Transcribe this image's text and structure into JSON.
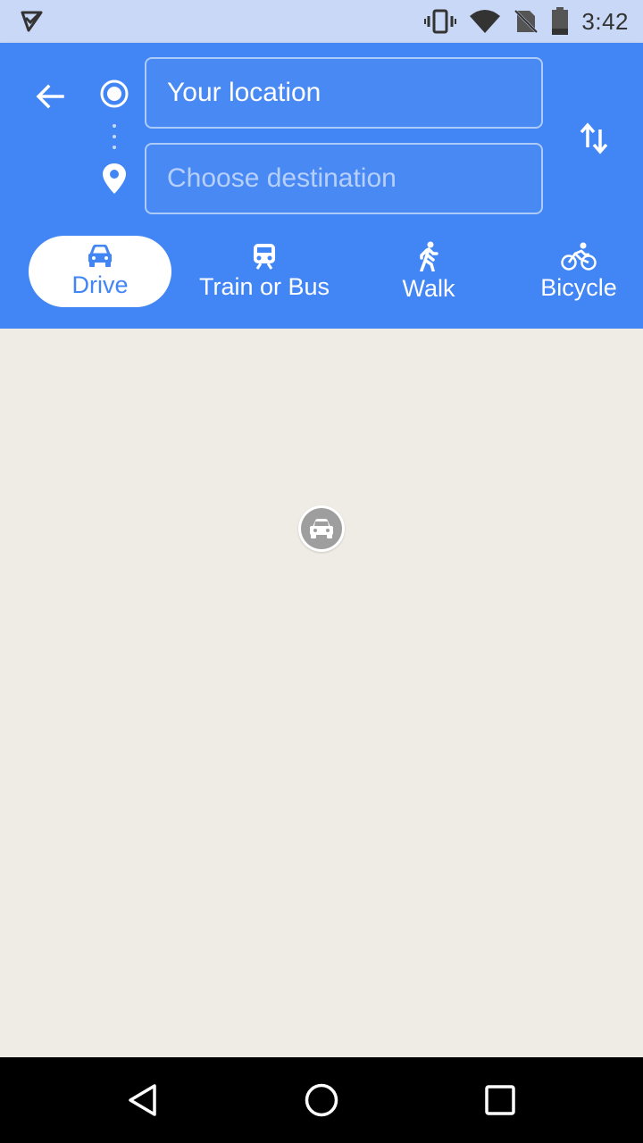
{
  "status_bar": {
    "time": "3:42",
    "icons": [
      "play-store-notification-icon",
      "vibrate-icon",
      "wifi-icon",
      "no-sim-icon",
      "battery-icon"
    ]
  },
  "directions": {
    "origin_value": "Your location",
    "destination_placeholder": "Choose destination",
    "back_icon": "arrow-back-icon",
    "swap_icon": "swap-vert-icon"
  },
  "modes": [
    {
      "label": "Drive",
      "icon": "car-icon",
      "selected": true
    },
    {
      "label": "Train or Bus",
      "icon": "train-icon",
      "selected": false
    },
    {
      "label": "Walk",
      "icon": "walk-icon",
      "selected": false
    },
    {
      "label": "Bicycle",
      "icon": "bicycle-icon",
      "selected": false
    }
  ],
  "map": {
    "background_color": "#efebe5",
    "marker_icon": "car-icon"
  },
  "colors": {
    "header": "#4285f4",
    "status_bar": "#c8d8f6",
    "active_mode_text": "#4285f4"
  },
  "nav_bar": {
    "buttons": [
      "back-triangle-icon",
      "home-circle-icon",
      "recents-square-icon"
    ]
  }
}
